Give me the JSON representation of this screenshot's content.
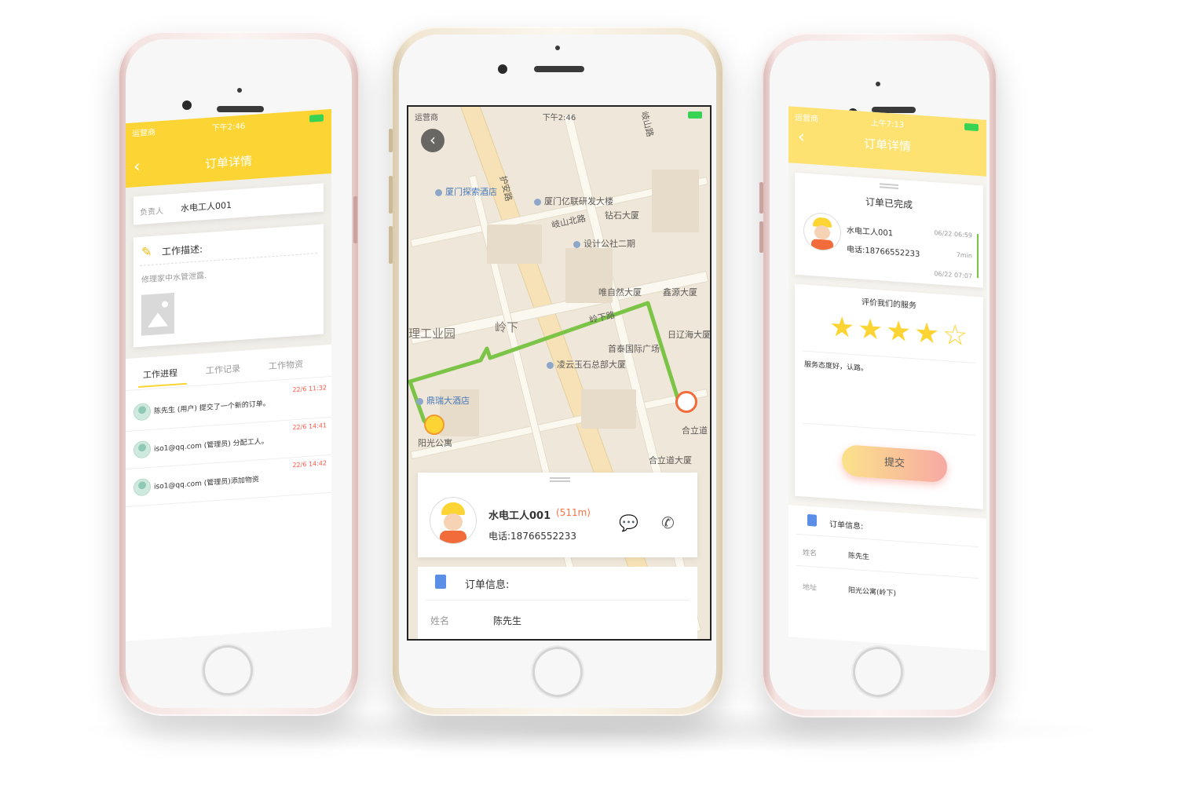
{
  "colors": {
    "accent_yellow": "#fcd534",
    "route_green": "#7cc448",
    "distance_red": "#ff7043",
    "timestamp_red": "#ff5b4d",
    "rose_gold_body": "#f4e3e1",
    "gold_body": "#f1e6d2"
  },
  "left_phone": {
    "status": {
      "carrier": "运营商",
      "time": "下午2:46"
    },
    "nav": {
      "title": "订单详情",
      "back_icon": "chevron-left-icon"
    },
    "owner": {
      "label": "负责人",
      "value": "水电工人001"
    },
    "work_desc": {
      "title": "工作描述:",
      "text": "修理家中水管泄露.",
      "icon": "pencil-icon"
    },
    "tabs": [
      {
        "label": "工作进程",
        "active": true
      },
      {
        "label": "工作记录",
        "active": false
      },
      {
        "label": "工作物资",
        "active": false
      }
    ],
    "progress": [
      {
        "text": "陈先生 (用户) 提交了一个新的订单。",
        "time": "22/6 11:32"
      },
      {
        "text": "iso1@qq.com (管理员) 分配工人。",
        "time": "22/6 14:41"
      },
      {
        "text": "iso1@qq.com (管理员)添加物资",
        "time": "22/6 14:42"
      }
    ]
  },
  "middle_phone": {
    "status": {
      "carrier": "运营商",
      "time": "下午2:46"
    },
    "map_labels": {
      "road_1": "岐山路",
      "hotel_1": "厦门探索酒店",
      "road_2": "护安路",
      "bld_1": "厦门亿联研发大楼",
      "road_3": "岐山北路",
      "bld_2": "钻石大厦",
      "bld_3": "设计公社二期",
      "area_1": "理工业园",
      "bld_4": "唯自然大厦",
      "bld_5": "鑫源大厦",
      "area_2": "岭下",
      "road_4": "岭下路",
      "bld_6": "日辽海大厦",
      "bld_7": "首泰国际广场",
      "bld_8": "凌云玉石总部大厦",
      "hotel_2": "鼎瑞大酒店",
      "dest": "阳光公寓",
      "bld_9": "合立道",
      "bld_10": "合立道大厦"
    },
    "worker": {
      "name": "水电工人001",
      "distance": "(511m)",
      "phone": "电话:18766552233",
      "message_icon": "chat-bubble-icon",
      "call_icon": "phone-icon"
    },
    "order_info": {
      "title": "订单信息:",
      "icon": "document-icon",
      "name_label": "姓名",
      "name_value": "陈先生"
    }
  },
  "right_phone": {
    "status": {
      "carrier": "运营商",
      "time": "上午7:13"
    },
    "nav": {
      "title": "订单详情",
      "back_icon": "chevron-left-icon"
    },
    "completed_title": "订单已完成",
    "worker": {
      "name": "水电工人001",
      "phone": "电话:18766552233",
      "time_start": "06/22 06:59",
      "duration": "7min",
      "time_end": "06/22 07:07"
    },
    "rating": {
      "title": "评价我们的服务",
      "score": 4,
      "max": 5,
      "comment": "服务态度好，认路。"
    },
    "submit_label": "提交",
    "order_info": {
      "title": "订单信息:",
      "name_label": "姓名",
      "name_value": "陈先生",
      "addr_label": "地址",
      "addr_value": "阳光公寓(岭下)"
    }
  }
}
